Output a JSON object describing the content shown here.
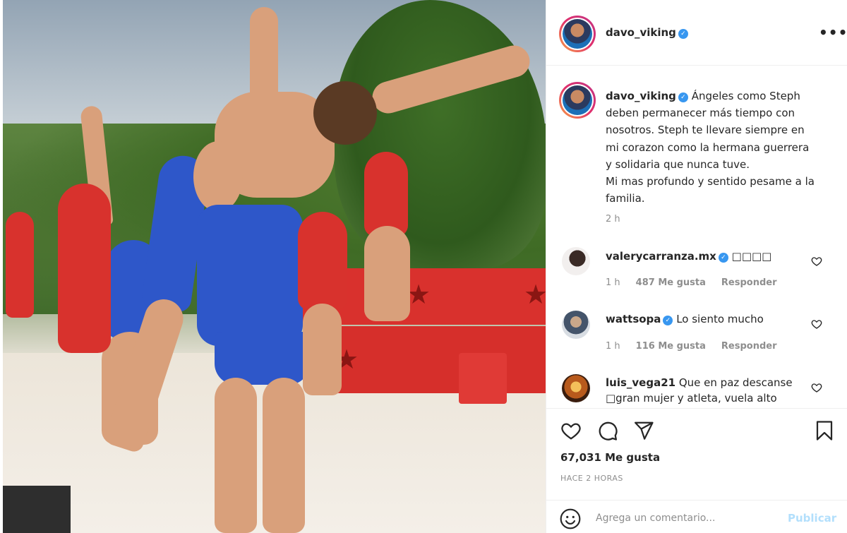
{
  "post": {
    "username": "davo_viking",
    "verified_icon": "verified-badge-icon",
    "more_icon": "more-options-icon"
  },
  "caption": {
    "username": "davo_viking",
    "text": "Ángeles como Steph deben permanecer más tiempo con nosotros. Steph te llevare siempre en mi corazon como la hermana guerrera y solidaria que nunca tuve.",
    "text2": "Mi mas profundo y sentido pesame a la familia.",
    "time": "2 h"
  },
  "comments": [
    {
      "username": "valerycarranza.mx",
      "verified": true,
      "text": "□□□□",
      "time": "1 h",
      "likes": "487 Me gusta",
      "reply": "Responder"
    },
    {
      "username": "wattsopa",
      "verified": true,
      "text": "Lo siento mucho",
      "time": "1 h",
      "likes": "116 Me gusta",
      "reply": "Responder"
    },
    {
      "username": "luis_vega21",
      "verified": false,
      "text": "Que en paz descanse □gran mujer y atleta, vuela alto"
    }
  ],
  "actions": {
    "likes": "67,031 Me gusta",
    "ago": "HACE 2 HORAS",
    "comment_placeholder": "Agrega un comentario...",
    "publish": "Publicar"
  },
  "colors": {
    "accent": "#3897f0",
    "publish_disabled": "#b2dffc",
    "muted": "#8e8e8e",
    "text": "#262626"
  }
}
